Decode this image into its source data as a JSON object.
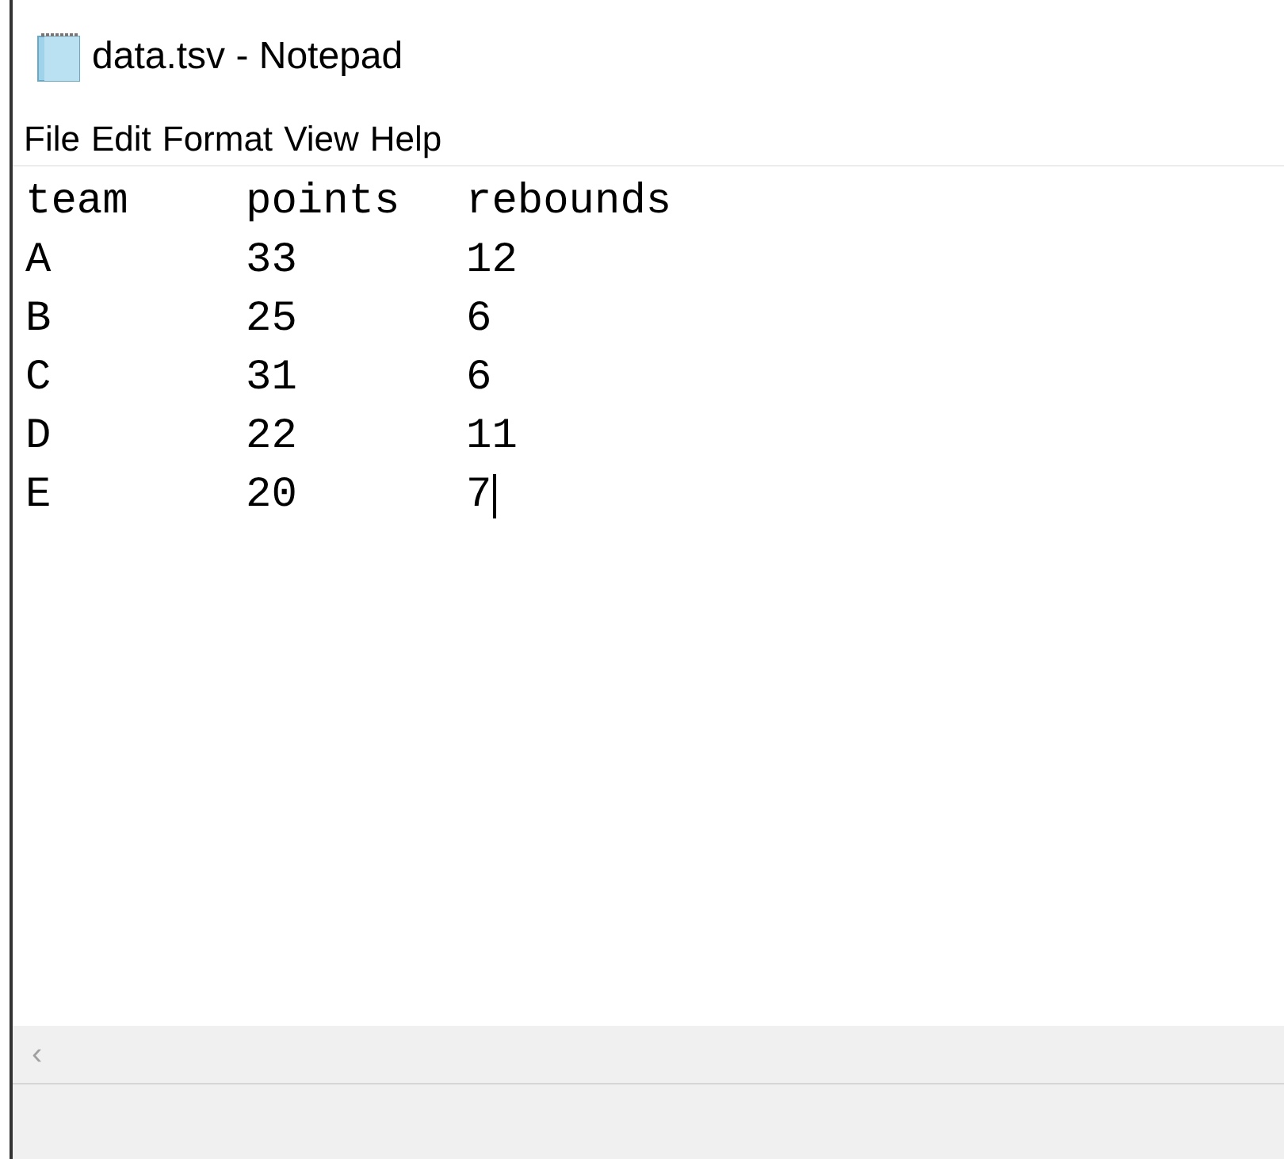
{
  "window": {
    "title": "data.tsv - Notepad"
  },
  "menu": [
    "File",
    "Edit",
    "Format",
    "View",
    "Help"
  ],
  "lines": [
    {
      "cells": [
        "team",
        "points",
        "rebounds"
      ],
      "caret": false
    },
    {
      "cells": [
        "A",
        "33",
        "12"
      ],
      "caret": false
    },
    {
      "cells": [
        "B",
        "25",
        "6"
      ],
      "caret": false
    },
    {
      "cells": [
        "C",
        "31",
        "6"
      ],
      "caret": false
    },
    {
      "cells": [
        "D",
        "22",
        "11"
      ],
      "caret": false
    },
    {
      "cells": [
        "E",
        "20",
        "7"
      ],
      "caret": true
    }
  ],
  "scrollbar": {
    "left_arrow": "‹"
  }
}
